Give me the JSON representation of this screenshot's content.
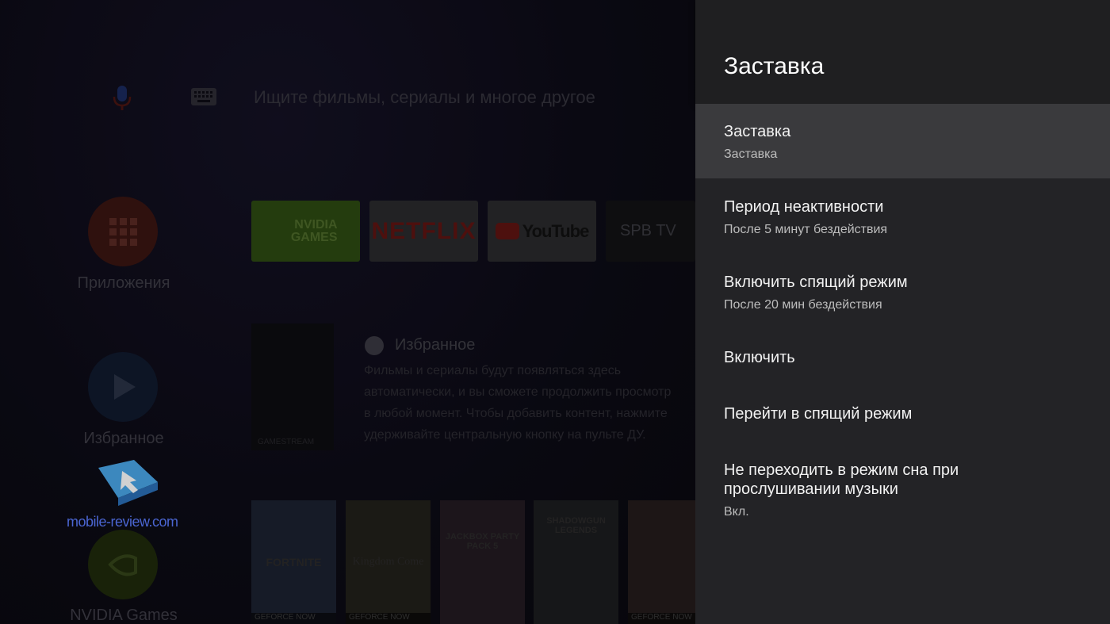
{
  "home": {
    "search_placeholder": "Ищите фильмы, сериалы и многое другое",
    "nav": [
      {
        "label": "Приложения",
        "icon": "apps-grid-icon",
        "color": "#3a1512"
      },
      {
        "label": "Избранное",
        "icon": "play-icon",
        "color": "#101a2e"
      },
      {
        "label": "NVIDIA Games",
        "icon": "nvidia-icon",
        "color": "#1f2a0b"
      }
    ],
    "apps": [
      {
        "label": "NVIDIA GAMES",
        "color": "#2d4a12"
      },
      {
        "label": "NETFLIX",
        "color": "#2a2a2c"
      },
      {
        "label": "YouTube",
        "color": "#2a2a2c"
      },
      {
        "label": "SPB TV",
        "color": "#121214"
      }
    ],
    "favorites": {
      "title": "Избранное",
      "desc_lines": [
        "Фильмы и сериалы будут появляться здесь",
        "автоматически, и вы сможете продолжить просмотр",
        "в любой момент. Чтобы добавить контент, нажмите",
        "удерживайте центральную кнопку на пульте ДУ."
      ],
      "poster_label": "GAMESTREAM"
    },
    "games": [
      {
        "title": "FORTNITE",
        "footer": "GEFORCE NOW",
        "color": "#1c2230"
      },
      {
        "title": "Kingdom Come",
        "footer": "GEFORCE NOW",
        "color": "#22201a"
      },
      {
        "title": "JACKBOX PARTY PACK 5",
        "footer": "",
        "color": "#231a22"
      },
      {
        "title": "SHADOWGUN LEGENDS",
        "footer": "",
        "color": "#1c1d1f"
      },
      {
        "title": "",
        "footer": "GEFORCE NOW",
        "color": "#241c1c"
      }
    ],
    "watermark": "mobile-review.com"
  },
  "panel": {
    "title": "Заставка",
    "items": [
      {
        "title": "Заставка",
        "subtitle": "Заставка"
      },
      {
        "title": "Период неактивности",
        "subtitle": "После 5 минут бездействия"
      },
      {
        "title": "Включить спящий режим",
        "subtitle": "После 20 мин бездействия"
      },
      {
        "title": "Включить"
      },
      {
        "title": "Перейти в спящий режим"
      },
      {
        "title": "Не переходить в режим сна при",
        "title2": "прослушивании музыки",
        "subtitle": "Вкл."
      }
    ]
  }
}
